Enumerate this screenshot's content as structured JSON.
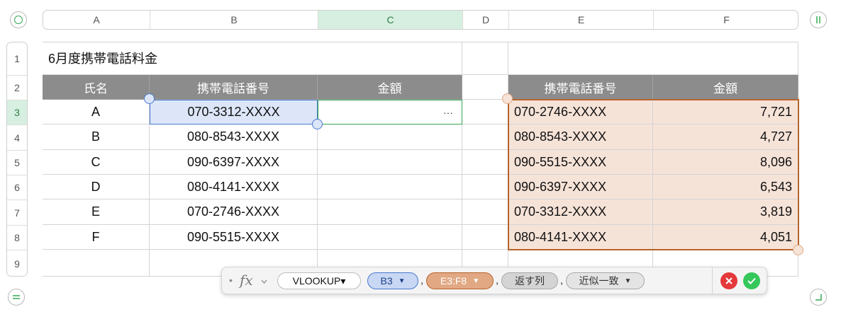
{
  "columns": [
    "A",
    "B",
    "C",
    "D",
    "E",
    "F"
  ],
  "selected_column": "C",
  "rows": [
    "1",
    "2",
    "3",
    "4",
    "5",
    "6",
    "7",
    "8",
    "9"
  ],
  "selected_row": "3",
  "sheet": {
    "title": "6月度携帯電話料金",
    "left_table": {
      "headers": [
        "氏名",
        "携帯電話番号",
        "金額"
      ],
      "names": [
        "A",
        "B",
        "C",
        "D",
        "E",
        "F"
      ],
      "phones": [
        "070-3312-XXXX",
        "080-8543-XXXX",
        "090-6397-XXXX",
        "080-4141-XXXX",
        "070-2746-XXXX",
        "090-5515-XXXX"
      ],
      "editing_cell_ellipsis": "···"
    },
    "right_table": {
      "headers": [
        "携帯電話番号",
        "金額"
      ],
      "phones": [
        "070-2746-XXXX",
        "080-8543-XXXX",
        "090-5515-XXXX",
        "090-6397-XXXX",
        "070-3312-XXXX",
        "080-4141-XXXX"
      ],
      "amounts": [
        "7,721",
        "4,727",
        "8,096",
        "6,543",
        "3,819",
        "4,051"
      ]
    }
  },
  "formula": {
    "bullet": "•",
    "fx_symbol": "fx",
    "function_name": "VLOOKUP▾",
    "arg1": "B3",
    "arg2": "E3:F8",
    "arg3": "返す列",
    "arg4": "近似一致",
    "comma": ","
  },
  "colors": {
    "select_green": "#34a853",
    "reference_blue": "#4a78d0",
    "reference_orange": "#b6642c",
    "header_gray": "#8c8c8c"
  },
  "icons": [
    "add-row-icon",
    "pause-icon",
    "equals-icon",
    "resize-corner-icon",
    "chevron-down-icon",
    "cancel-icon",
    "confirm-icon"
  ]
}
